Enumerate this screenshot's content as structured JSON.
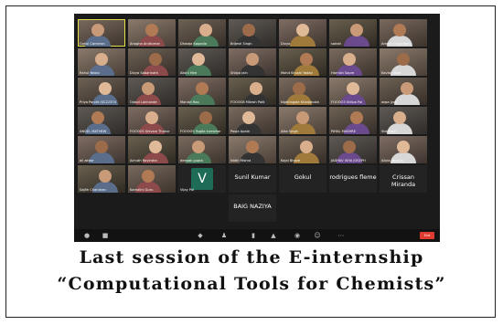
{
  "caption": {
    "line1": "Last session of the E-internship",
    "line2": "“Computational Tools for Chemists”"
  },
  "meeting": {
    "view_label": "",
    "end_label": "End"
  },
  "participants": [
    {
      "name": "Gokul Cameron",
      "kind": "video",
      "active": true
    },
    {
      "name": "Anagha Anilkumar",
      "kind": "video"
    },
    {
      "name": "Dhwaja Kapadia",
      "kind": "video"
    },
    {
      "name": "Brijesh Singh",
      "kind": "video"
    },
    {
      "name": "Divya",
      "kind": "video"
    },
    {
      "name": "sakshi",
      "kind": "video"
    },
    {
      "name": "Ambar Choudhary",
      "kind": "video"
    },
    {
      "name": "Rahul Yadav",
      "kind": "video"
    },
    {
      "name": "Divya Sabarinath",
      "kind": "video"
    },
    {
      "name": "Akshi Hire",
      "kind": "video"
    },
    {
      "name": "Shilpa Jain",
      "kind": "video"
    },
    {
      "name": "Mohd Khushi Yadav",
      "kind": "video"
    },
    {
      "name": "Harnish Sapre",
      "kind": "video"
    },
    {
      "name": "Kavish Vaze",
      "kind": "video"
    },
    {
      "name": "Priya Pandit (SC22374",
      "kind": "video"
    },
    {
      "name": "Ojasvi Lokhande",
      "kind": "video"
    },
    {
      "name": "Manish Rao",
      "kind": "video"
    },
    {
      "name": "FOOOO8 Mitesh Patil",
      "kind": "video"
    },
    {
      "name": "Nightingale Khadandah",
      "kind": "video"
    },
    {
      "name": "FOOOO3 Shilpa Pai",
      "kind": "video"
    },
    {
      "name": "aqsa jyoti",
      "kind": "video"
    },
    {
      "name": "ANGEL MATHEW",
      "kind": "video"
    },
    {
      "name": "FOOOOS Shivani Thakur",
      "kind": "video"
    },
    {
      "name": "FOOOOS Yogita kumbhar",
      "kind": "video"
    },
    {
      "name": "Pooja Apale",
      "kind": "video"
    },
    {
      "name": "Alka Singh",
      "kind": "video"
    },
    {
      "name": "PAYAL MASHRE",
      "kind": "video"
    },
    {
      "name": "Siddhesh",
      "kind": "video"
    },
    {
      "name": "ali akbar",
      "kind": "video"
    },
    {
      "name": "Achuth Ravindra",
      "kind": "video"
    },
    {
      "name": "deepak gupta",
      "kind": "video"
    },
    {
      "name": "Nidhi Mishra",
      "kind": "video"
    },
    {
      "name": "Kajal Bhave",
      "kind": "video"
    },
    {
      "name": "JADHAV ISHA JOSEPH",
      "kind": "video"
    },
    {
      "name": "Alicia Dsouza",
      "kind": "video"
    },
    {
      "name": "Sajith Chandran",
      "kind": "video"
    },
    {
      "name": "Kamalini Guru",
      "kind": "video"
    },
    {
      "name": "Vijay Pal",
      "kind": "avatar",
      "letter": "V"
    },
    {
      "name": "Sunil Kumar",
      "kind": "blank"
    },
    {
      "name": "Gokul",
      "kind": "blank"
    },
    {
      "name": "rodrigues fleme",
      "kind": "blank"
    },
    {
      "name": "Crissan Miranda",
      "kind": "blank"
    },
    {
      "name": "BAIG NAZIYA",
      "kind": "blank"
    }
  ]
}
